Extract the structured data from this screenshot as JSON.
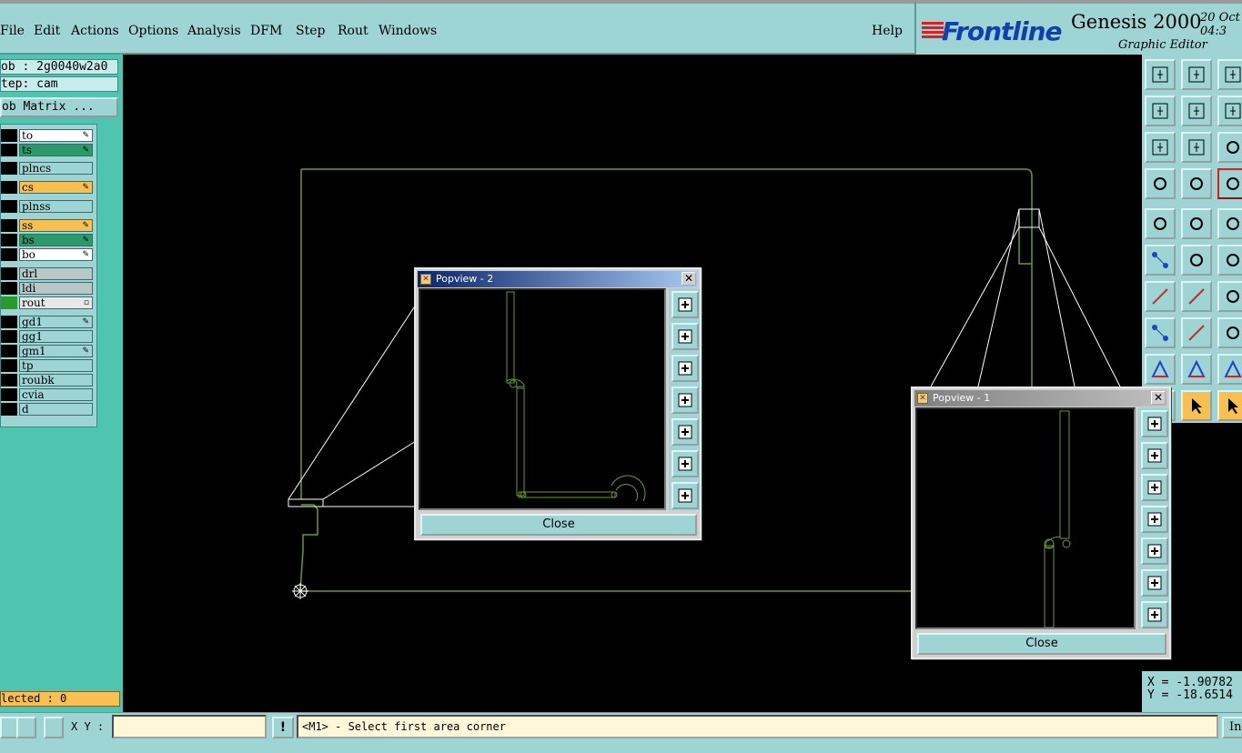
{
  "menubar": {
    "items": [
      "File",
      "Edit",
      "Actions",
      "Options",
      "Analysis",
      "DFM",
      "Step",
      "Rout",
      "Windows"
    ],
    "help": "Help"
  },
  "brand": {
    "logo": "Frontline",
    "product": "Genesis 2000",
    "subtitle": "Graphic Editor",
    "date_line1": "20 Oct",
    "date_line2": "04:3"
  },
  "job": {
    "job_field": "ob : 2g0040w2a0",
    "step_field": "tep: cam",
    "matrix_button": "ob Matrix ..."
  },
  "layers": [
    {
      "name": "to",
      "color": "#ffffff",
      "swatch": "#000000",
      "mark": true
    },
    {
      "name": "ts",
      "color": "#2a9a6a",
      "swatch": "#000000",
      "mark": true
    },
    {
      "name": "plncs",
      "color": "#9ed4d4",
      "swatch": "#000000",
      "mark": false
    },
    {
      "name": "cs",
      "color": "#f8c050",
      "swatch": "#000000",
      "mark": true
    },
    {
      "name": "plnss",
      "color": "#9ed4d4",
      "swatch": "#000000",
      "mark": false
    },
    {
      "name": "ss",
      "color": "#f8c050",
      "swatch": "#000000",
      "mark": true
    },
    {
      "name": "bs",
      "color": "#2a9a6a",
      "swatch": "#000000",
      "mark": true
    },
    {
      "name": "bo",
      "color": "#ffffff",
      "swatch": "#000000",
      "mark": true
    },
    {
      "name": "drl",
      "color": "#b8c8c8",
      "swatch": "#000000",
      "mark": false
    },
    {
      "name": "ldi",
      "color": "#b8c8c8",
      "swatch": "#000000",
      "mark": false
    },
    {
      "name": "rout",
      "color": "#e8e8e8",
      "swatch": "#2a9a2a",
      "mark": false,
      "box": true
    },
    {
      "name": "gd1",
      "color": "#9ed4d4",
      "swatch": "#000000",
      "mark": true
    },
    {
      "name": "gg1",
      "color": "#9ed4d4",
      "swatch": "#000000",
      "mark": false
    },
    {
      "name": "gm1",
      "color": "#9ed4d4",
      "swatch": "#000000",
      "mark": true
    },
    {
      "name": "tp",
      "color": "#9ed4d4",
      "swatch": "#000000",
      "mark": false
    },
    {
      "name": "roubk",
      "color": "#9ed4d4",
      "swatch": "#000000",
      "mark": false
    },
    {
      "name": "cvia",
      "color": "#9ed4d4",
      "swatch": "#000000",
      "mark": false
    },
    {
      "name": "d",
      "color": "#9ed4d4",
      "swatch": "#000000",
      "mark": false
    }
  ],
  "selected": "lected : 0",
  "coords": {
    "x": "X = -1.90782",
    "y": "Y = -18.6514"
  },
  "popview2": {
    "title": "Popview - 2",
    "close": "Close"
  },
  "popview1": {
    "title": "Popview - 1",
    "close": "Close"
  },
  "statusbar": {
    "xy_label": "X Y :",
    "xy_value": "",
    "bang": "!",
    "prompt": "<M1> - Select first area corner",
    "right_button": "In"
  },
  "colors": {
    "panel": "#9ed4d4",
    "outline": "#6a9a2a",
    "left_panel": "#4fc5b0"
  }
}
